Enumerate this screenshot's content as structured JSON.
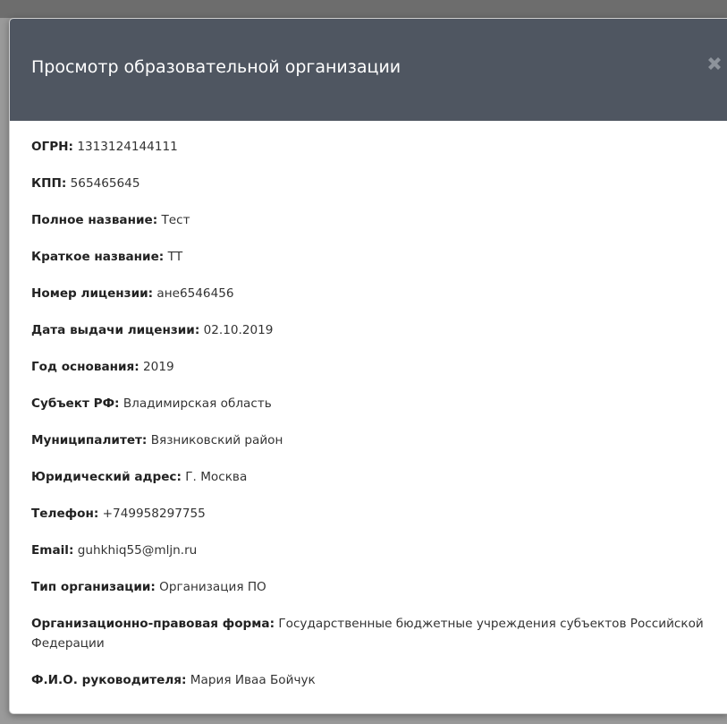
{
  "modal": {
    "title": "Просмотр образовательной организации",
    "close_icon": "close-x-icon"
  },
  "fields": [
    {
      "label": "ОГРН:",
      "value": "1313124144111"
    },
    {
      "label": "КПП:",
      "value": "565465645"
    },
    {
      "label": "Полное название:",
      "value": "Тест"
    },
    {
      "label": "Краткое название:",
      "value": "ТТ"
    },
    {
      "label": "Номер лицензии:",
      "value": "ане6546456"
    },
    {
      "label": "Дата выдачи лицензии:",
      "value": "02.10.2019"
    },
    {
      "label": "Год основания:",
      "value": "2019"
    },
    {
      "label": "Субъект РФ:",
      "value": "Владимирская область"
    },
    {
      "label": "Муниципалитет:",
      "value": "Вязниковский район"
    },
    {
      "label": "Юридический адрес:",
      "value": "Г. Москва"
    },
    {
      "label": "Телефон:",
      "value": "+749958297755"
    },
    {
      "label": "Email:",
      "value": "guhkhiq55@mljn.ru"
    },
    {
      "label": "Тип организации:",
      "value": "Организация ПО"
    },
    {
      "label": "Организационно-правовая форма:",
      "value": "Государственные бюджетные учреждения субъектов Российской Федерации"
    },
    {
      "label": "Ф.И.О. руководителя:",
      "value": "Мария Иваа Бойчук"
    }
  ],
  "colors": {
    "header_bg": "#4f5661",
    "header_text": "#ffffff",
    "close_icon": "#8d939b",
    "body_bg": "#ffffff",
    "text": "#333333"
  }
}
